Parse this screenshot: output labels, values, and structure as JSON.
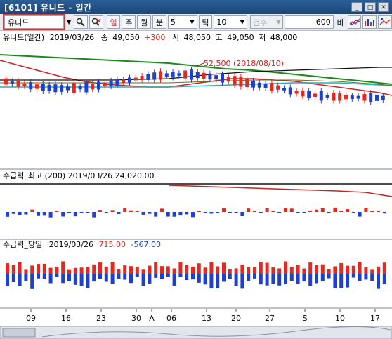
{
  "window": {
    "title": "[6101] 유니드 - 일간",
    "minimize": "_",
    "restore": "□",
    "close": "✕"
  },
  "toolbar": {
    "stock_name": "유니드",
    "period_day": "일",
    "period_week": "주",
    "period_month": "월",
    "period_min": "분",
    "minute_value": "5",
    "tick_label": "틱",
    "tick_value": "10",
    "count_mode": "건수",
    "count_value": "600",
    "count_unit": "바"
  },
  "price_panel": {
    "header_name": "유니드(일간)",
    "header_date": "2019/03/26",
    "close_label": "종",
    "close_value": "49,050",
    "change_value": "+300",
    "open_label": "시",
    "open_value": "48,050",
    "high_label": "고",
    "high_value": "49,050",
    "low_label": "저",
    "low_value": "48,000",
    "annotation": "52,500 (2018/08/10)"
  },
  "supply_max_panel": {
    "header": "수급력_최고 (200) 2019/03/26 24,020.00"
  },
  "supply_day_panel": {
    "header_prefix": "수급력_당일",
    "header_date": "2019/03/26",
    "positive_value": "715.00",
    "negative_value": "-567.00"
  },
  "x_axis": {
    "ticks": [
      "09",
      "16",
      "23",
      "30",
      "A",
      "06",
      "13",
      "20",
      "27",
      "S",
      "10",
      "17"
    ]
  },
  "colors": {
    "up": "#e8281e",
    "down": "#1f3fcf",
    "ma_green": "#1a8a1a",
    "ma_red": "#cc2222",
    "ma_cyan": "#19b4c4"
  },
  "chart_data": {
    "type": "candlestick",
    "annotation_high": 52500,
    "last_candle": {
      "date": "2019/03/26",
      "open": 48050,
      "high": 49050,
      "low": 48000,
      "close": 49050
    }
  }
}
